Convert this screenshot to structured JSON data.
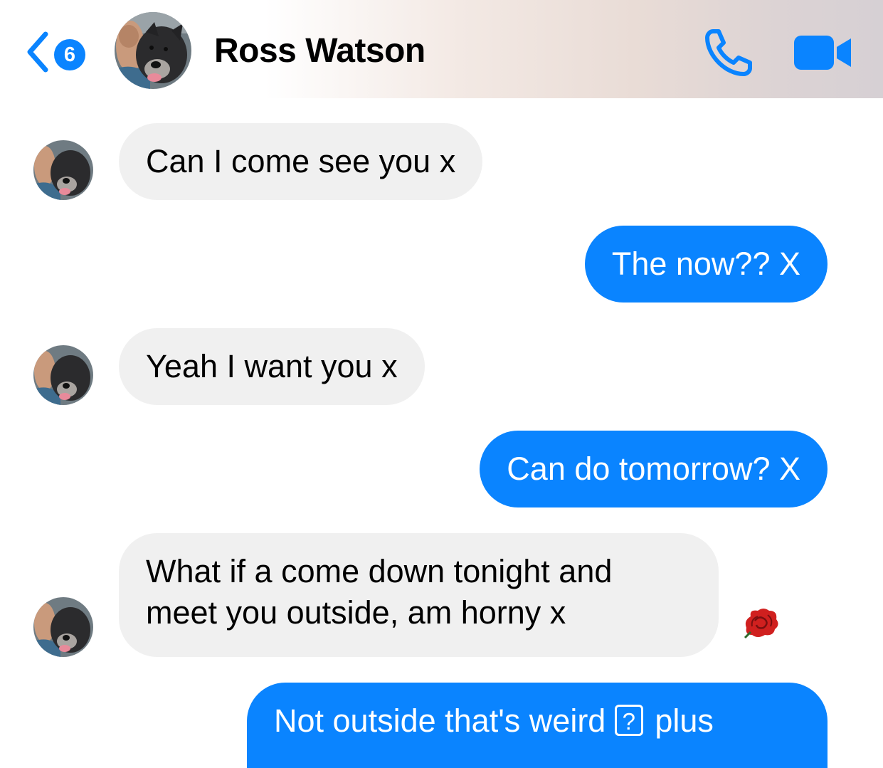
{
  "header": {
    "unread_count": "6",
    "contact_name": "Ross Watson",
    "back_icon": "chevron-left-icon",
    "call_icon": "phone-icon",
    "video_icon": "video-camera-icon"
  },
  "messages": [
    {
      "direction": "incoming",
      "text": "Can I come see you x"
    },
    {
      "direction": "outgoing",
      "text": "The now?? X"
    },
    {
      "direction": "incoming",
      "text": "Yeah I want you x"
    },
    {
      "direction": "outgoing",
      "text": "Can do tomorrow? X"
    },
    {
      "direction": "incoming",
      "text": "What if a come down tonight and meet you outside, am horny x",
      "reaction_icon": "rose-icon"
    },
    {
      "direction": "outgoing",
      "text_before": "Not outside that's weird",
      "glyph": "?",
      "text_after": "plus"
    }
  ],
  "colors": {
    "accent": "#0a84ff",
    "incoming_bubble": "#f0f0f0",
    "outgoing_bubble": "#0a84ff"
  }
}
